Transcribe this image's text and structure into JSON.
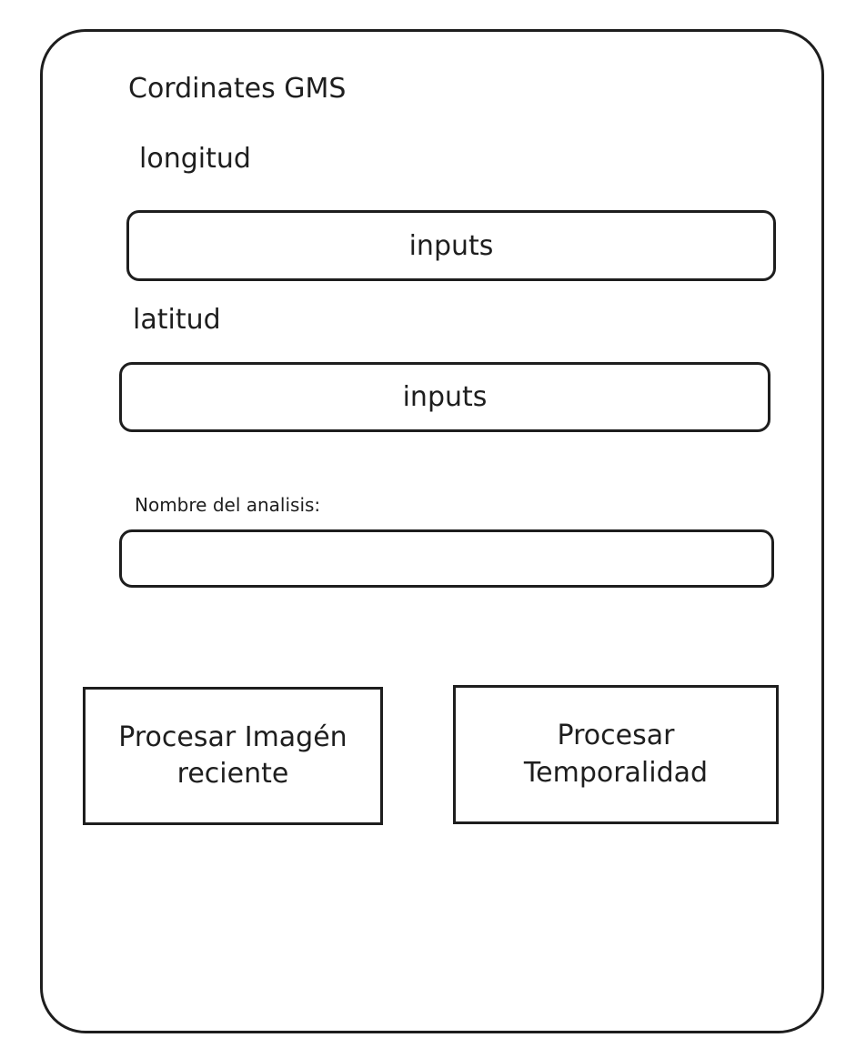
{
  "form": {
    "title": "Cordinates GMS",
    "longitude": {
      "label": "longitud",
      "value": "inputs"
    },
    "latitude": {
      "label": "latitud",
      "value": "inputs"
    },
    "analysis_name": {
      "label": "Nombre del analisis:",
      "value": ""
    }
  },
  "actions": {
    "process_recent_label": "Procesar Imagén reciente",
    "process_temporal_label": "Procesar Temporalidad"
  }
}
